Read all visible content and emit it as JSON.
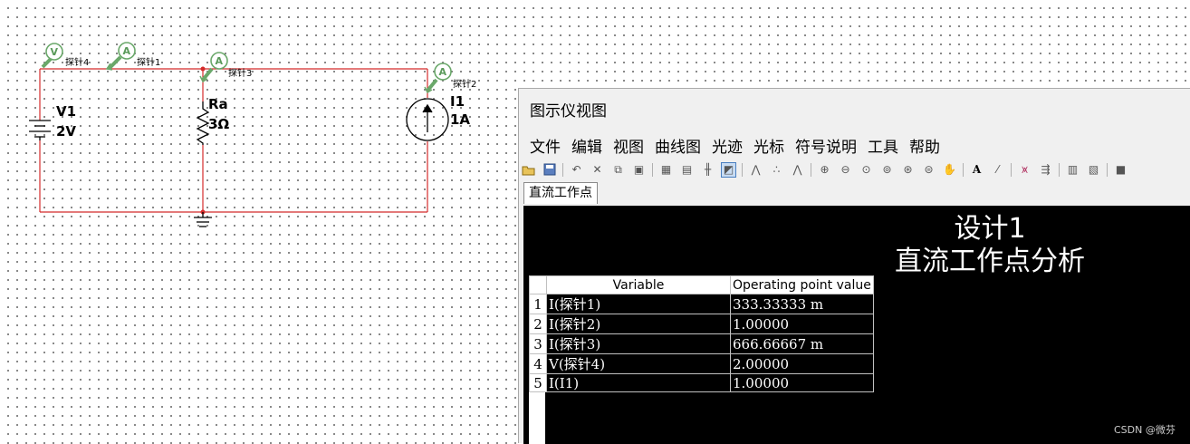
{
  "schematic": {
    "components": {
      "v1": {
        "name": "V1",
        "value": "2V"
      },
      "ra": {
        "name": "Ra",
        "value": "3Ω"
      },
      "i1": {
        "name": "I1",
        "value": "1A"
      }
    },
    "probes": [
      {
        "letter": "V",
        "label": "探针4"
      },
      {
        "letter": "A",
        "label": "探针1"
      },
      {
        "letter": "A",
        "label": "探针3"
      },
      {
        "letter": "A",
        "label": "探针2"
      }
    ],
    "colors": {
      "wire": "#d42b2b",
      "probe": "#6aa86a",
      "component": "#000000"
    }
  },
  "grapher": {
    "title": "图示仪视图",
    "menu": [
      "文件",
      "编辑",
      "视图",
      "曲线图",
      "光迹",
      "光标",
      "符号说明",
      "工具",
      "帮助"
    ],
    "toolbar_icons": [
      "open-icon",
      "save-icon",
      "undo-icon",
      "delete-icon",
      "copy-icon",
      "paste-icon",
      "grid-icon",
      "legend-icon",
      "axis-icon",
      "invert-icon",
      "cursor-icon",
      "cursor2-icon",
      "cursor3-icon",
      "zoom-in-icon",
      "zoom-out-icon",
      "zoom-fit-icon",
      "zoom-x-icon",
      "zoom-y-icon",
      "zoom-rect-icon",
      "pan-icon",
      "text-icon",
      "label-icon",
      "trace-icon",
      "export-icon",
      "page-icon",
      "page2-icon",
      "stop-icon"
    ],
    "tab": "直流工作点",
    "view": {
      "title_line1": "设计1",
      "title_line2": "直流工作点分析",
      "headers": [
        "Variable",
        "Operating point value"
      ],
      "rows": [
        {
          "n": "1",
          "var": "I(探针1)",
          "val": "333.33333 m"
        },
        {
          "n": "2",
          "var": "I(探针2)",
          "val": "1.00000"
        },
        {
          "n": "3",
          "var": "I(探针3)",
          "val": "666.66667 m"
        },
        {
          "n": "4",
          "var": "V(探针4)",
          "val": "2.00000"
        },
        {
          "n": "5",
          "var": "I(I1)",
          "val": "1.00000"
        }
      ]
    }
  },
  "watermark": "CSDN @微芬"
}
